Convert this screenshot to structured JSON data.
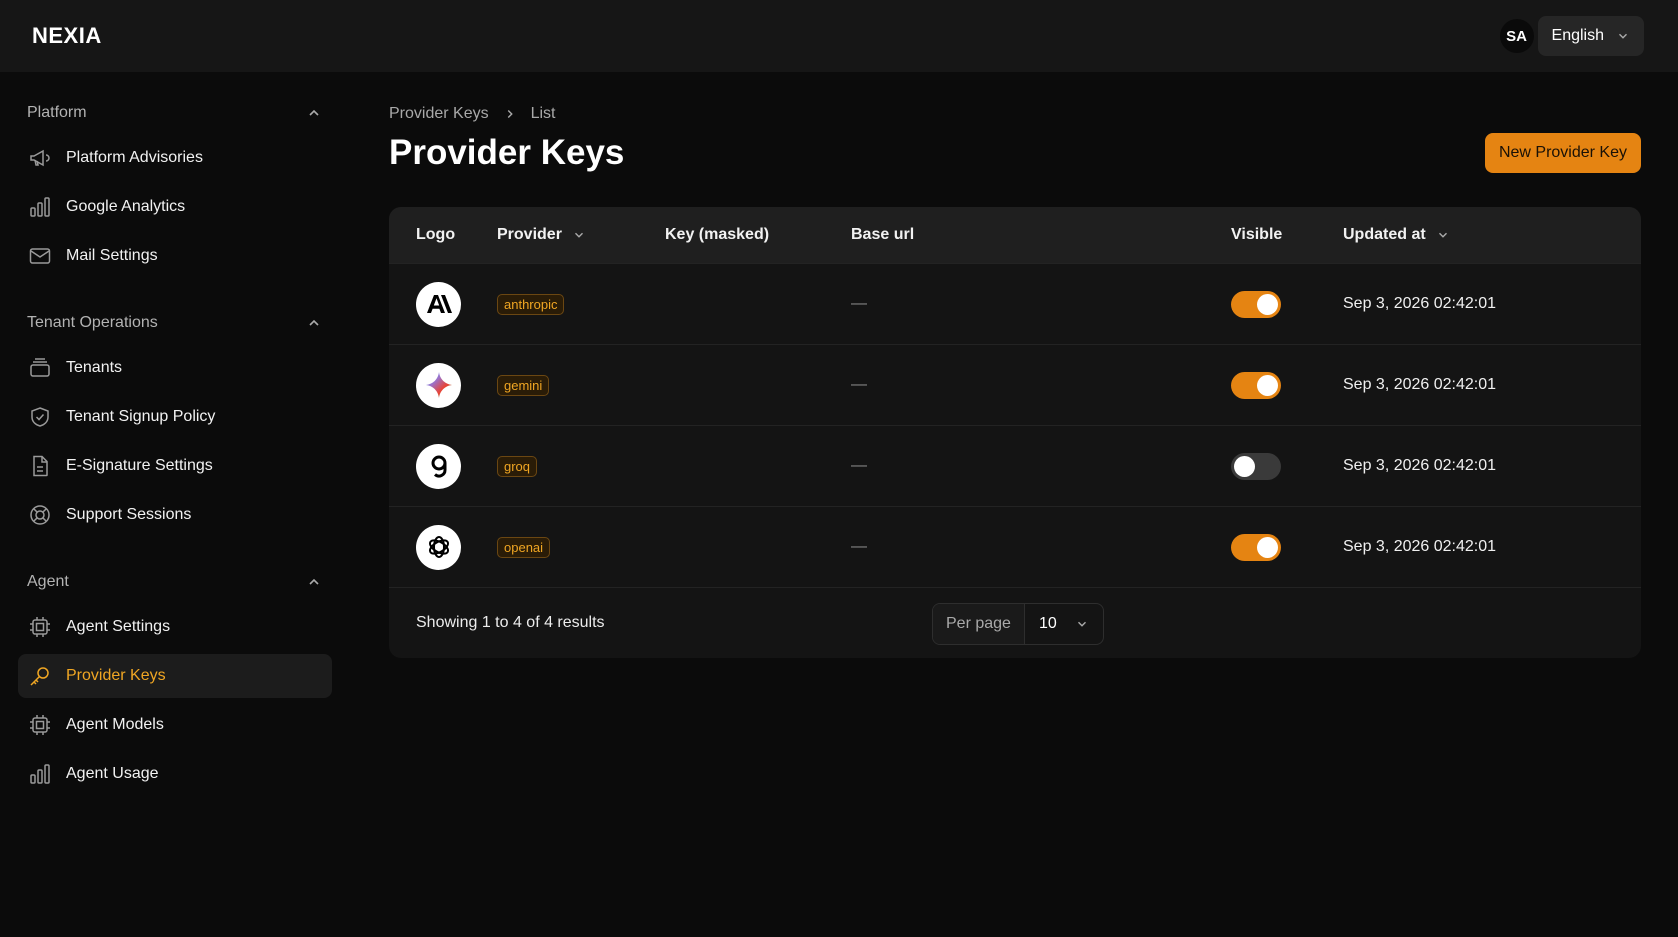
{
  "app": {
    "brand": "NEXIA",
    "accent": "#e58412"
  },
  "user": {
    "initials": "SA",
    "language": "English"
  },
  "sidebar": {
    "groups": [
      {
        "label": "Platform",
        "items": [
          {
            "label": "Platform Advisories",
            "icon": "megaphone-icon"
          },
          {
            "label": "Google Analytics",
            "icon": "bar-chart-icon"
          },
          {
            "label": "Mail Settings",
            "icon": "envelope-icon"
          }
        ]
      },
      {
        "label": "Tenant Operations",
        "items": [
          {
            "label": "Tenants",
            "icon": "folder-stack-icon"
          },
          {
            "label": "Tenant Signup Policy",
            "icon": "shield-check-icon"
          },
          {
            "label": "E-Signature Settings",
            "icon": "document-icon"
          },
          {
            "label": "Support Sessions",
            "icon": "lifebuoy-icon"
          }
        ]
      },
      {
        "label": "Agent",
        "items": [
          {
            "label": "Agent Settings",
            "icon": "cpu-chip-icon"
          },
          {
            "label": "Provider Keys",
            "icon": "key-icon",
            "active": true
          },
          {
            "label": "Agent Models",
            "icon": "cpu-chip-icon"
          },
          {
            "label": "Agent Usage",
            "icon": "bar-chart-icon"
          }
        ]
      }
    ]
  },
  "breadcrumb": {
    "root": "Provider Keys",
    "current": "List"
  },
  "page": {
    "title": "Provider Keys",
    "new_button": "New Provider Key"
  },
  "table": {
    "columns": {
      "logo": "Logo",
      "provider": "Provider",
      "key": "Key (masked)",
      "base_url": "Base url",
      "visible": "Visible",
      "updated": "Updated at"
    },
    "rows": [
      {
        "provider": "anthropic",
        "logo": "anthropic-logo-icon",
        "key": "",
        "base_url": "—",
        "visible": true,
        "updated": "Sep 3, 2026 02:42:01"
      },
      {
        "provider": "gemini",
        "logo": "gemini-logo-icon",
        "key": "",
        "base_url": "—",
        "visible": true,
        "updated": "Sep 3, 2026 02:42:01"
      },
      {
        "provider": "groq",
        "logo": "groq-logo-icon",
        "key": "",
        "base_url": "—",
        "visible": false,
        "updated": "Sep 3, 2026 02:42:01"
      },
      {
        "provider": "openai",
        "logo": "openai-logo-icon",
        "key": "",
        "base_url": "—",
        "visible": true,
        "updated": "Sep 3, 2026 02:42:01"
      }
    ],
    "footer": {
      "summary": "Showing 1 to 4 of 4 results",
      "per_page_label": "Per page",
      "per_page_value": "10"
    }
  }
}
